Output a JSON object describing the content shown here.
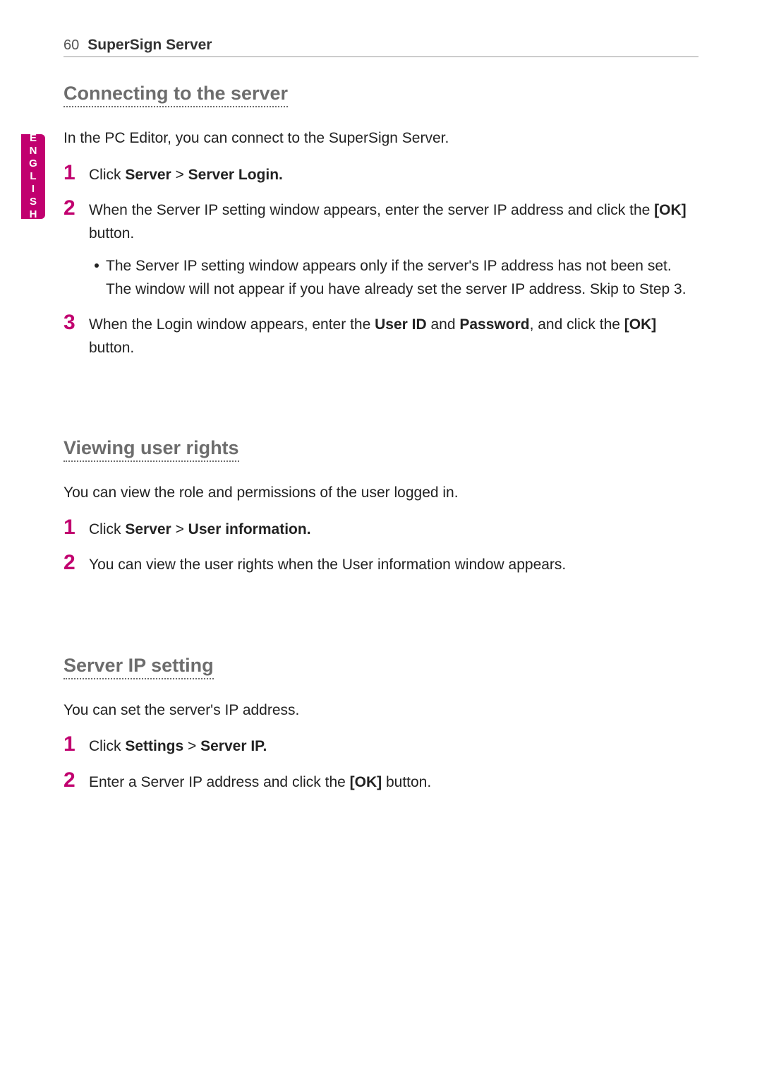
{
  "header": {
    "page_number": "60",
    "title": "SuperSign Server"
  },
  "side_tab": "ENGLISH",
  "sections": [
    {
      "title": "Connecting to the server",
      "intro": "In the PC Editor, you can connect to the SuperSign Server.",
      "steps": [
        {
          "num": "1",
          "parts": [
            "Click ",
            "Server",
            " > ",
            "Server Login."
          ],
          "bold": [
            false,
            true,
            false,
            true
          ]
        },
        {
          "num": "2",
          "parts": [
            "When the Server IP setting window appears, enter the server IP address and click the ",
            "[OK]",
            " button."
          ],
          "bold": [
            false,
            true,
            false
          ],
          "sub": {
            "text": "The Server IP setting window appears only if the server's IP address has not been set. The window will not appear if you have already set the server IP address. Skip to Step 3."
          }
        },
        {
          "num": "3",
          "parts": [
            "When the Login window appears, enter the ",
            "User ID",
            " and ",
            "Password",
            ", and click the ",
            "[OK]",
            " button."
          ],
          "bold": [
            false,
            true,
            false,
            true,
            false,
            true,
            false
          ]
        }
      ]
    },
    {
      "title": "Viewing user rights",
      "intro": "You can view the role and permissions of the user logged in.",
      "steps": [
        {
          "num": "1",
          "parts": [
            "Click ",
            "Server",
            " > ",
            "User information."
          ],
          "bold": [
            false,
            true,
            false,
            true
          ]
        },
        {
          "num": "2",
          "parts": [
            "You can view the user rights when the User information window appears."
          ],
          "bold": [
            false
          ]
        }
      ]
    },
    {
      "title": "Server IP setting",
      "intro": "You can set the server's IP address.",
      "steps": [
        {
          "num": "1",
          "parts": [
            "Click ",
            "Settings",
            " > ",
            "Server IP."
          ],
          "bold": [
            false,
            true,
            false,
            true
          ]
        },
        {
          "num": "2",
          "parts": [
            "Enter a Server IP address and click the ",
            "[OK]",
            " button."
          ],
          "bold": [
            false,
            true,
            false
          ]
        }
      ]
    }
  ]
}
